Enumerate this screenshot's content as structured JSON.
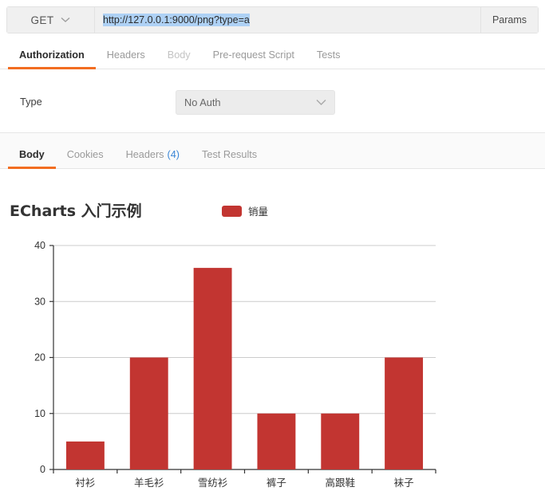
{
  "request": {
    "method": "GET",
    "method_icon": "chevron-down-icon",
    "url": "http://127.0.0.1:9000/png?type=a",
    "params_label": "Params",
    "tabs": [
      {
        "label": "Authorization",
        "state": "active"
      },
      {
        "label": "Headers",
        "state": "normal"
      },
      {
        "label": "Body",
        "state": "muted"
      },
      {
        "label": "Pre-request Script",
        "state": "normal"
      },
      {
        "label": "Tests",
        "state": "normal"
      }
    ],
    "auth": {
      "type_label": "Type",
      "selected": "No Auth",
      "caret_icon": "chevron-down-icon"
    }
  },
  "response": {
    "tabs": [
      {
        "label": "Body",
        "count": "",
        "state": "active"
      },
      {
        "label": "Cookies",
        "count": "",
        "state": "normal"
      },
      {
        "label": "Headers",
        "count": "(4)",
        "state": "normal"
      },
      {
        "label": "Test Results",
        "count": "",
        "state": "normal"
      }
    ]
  },
  "colors": {
    "accent_orange": "#f26d21",
    "bar_red": "#c23531",
    "link_blue": "#3a86d6",
    "selection_blue": "#aed1f5"
  },
  "chart_data": {
    "type": "bar",
    "title": "ECharts 入门示例",
    "xlabel": "",
    "ylabel": "",
    "ylim": [
      0,
      40
    ],
    "yticks": [
      0,
      10,
      20,
      30,
      40
    ],
    "grid": true,
    "legend": [
      "销量"
    ],
    "legend_position": "top-center",
    "categories": [
      "衬衫",
      "羊毛衫",
      "雪纺衫",
      "裤子",
      "高跟鞋",
      "袜子"
    ],
    "series": [
      {
        "name": "销量",
        "color": "#c23531",
        "values": [
          5,
          20,
          36,
          10,
          10,
          20
        ]
      }
    ]
  }
}
